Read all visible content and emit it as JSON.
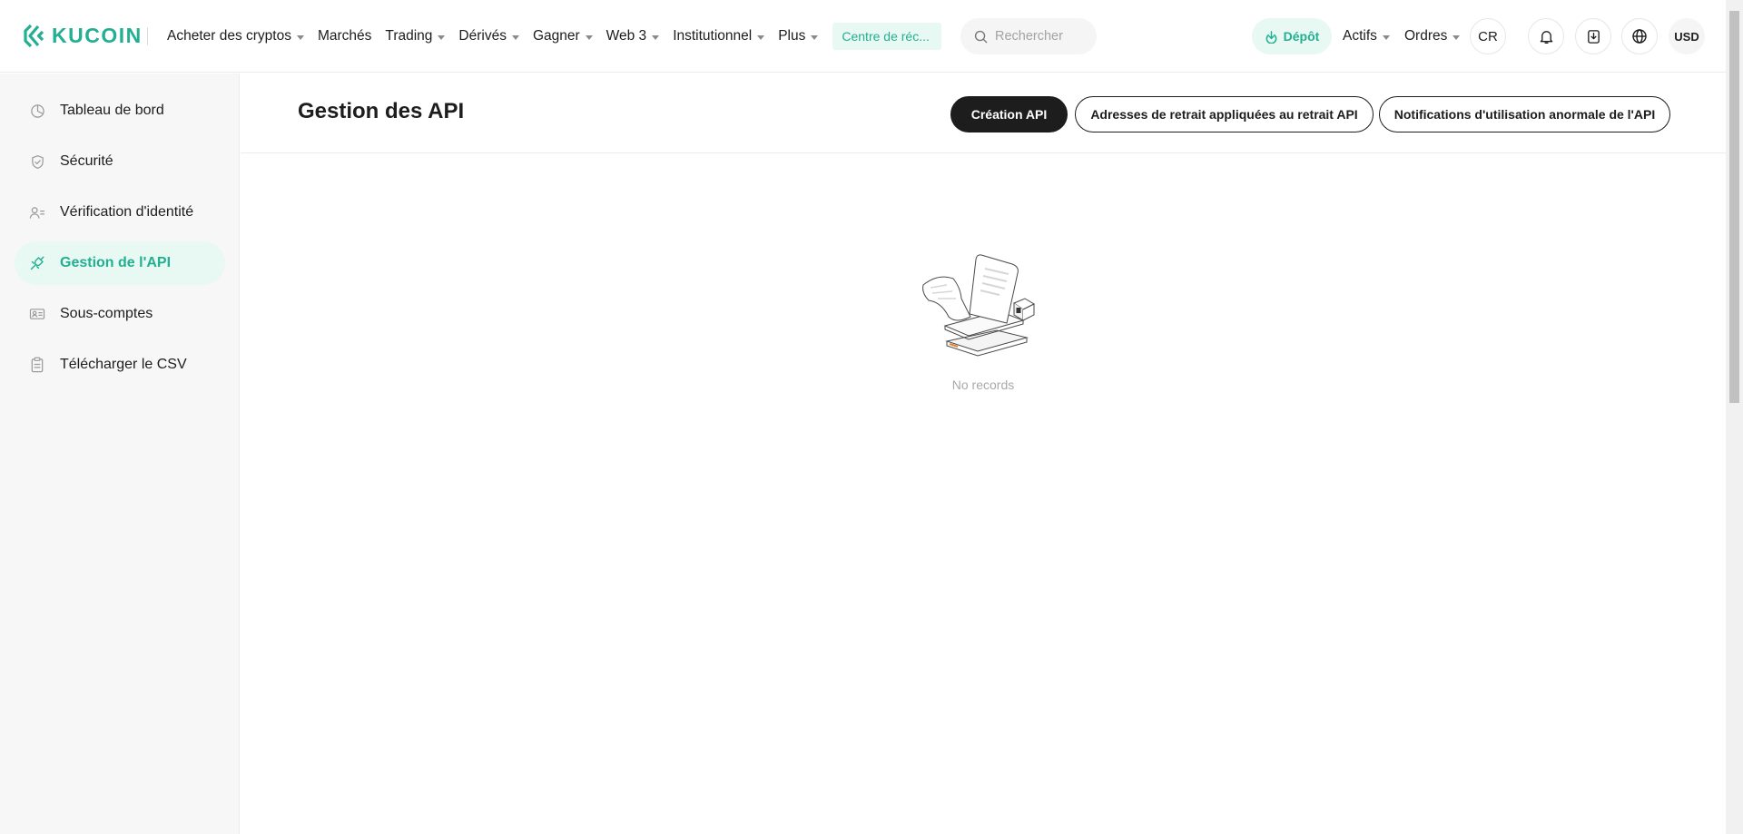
{
  "brand": {
    "name": "KUCOIN",
    "color": "#23af91"
  },
  "nav": {
    "items": [
      {
        "label": "Acheter des cryptos",
        "dropdown": true
      },
      {
        "label": "Marchés",
        "dropdown": false
      },
      {
        "label": "Trading",
        "dropdown": true
      },
      {
        "label": "Dérivés",
        "dropdown": true
      },
      {
        "label": "Gagner",
        "dropdown": true
      },
      {
        "label": "Web 3",
        "dropdown": true
      },
      {
        "label": "Institutionnel",
        "dropdown": true
      },
      {
        "label": "Plus",
        "dropdown": true
      }
    ],
    "promo": "Centre de réc...",
    "search_placeholder": "Rechercher"
  },
  "header_right": {
    "deposit": "Dépôt",
    "assets": "Actifs",
    "orders": "Ordres",
    "avatar": "CR",
    "currency": "USD",
    "icons": [
      "bell-icon",
      "download-icon",
      "globe-icon"
    ]
  },
  "sidebar": {
    "items": [
      {
        "label": "Tableau de bord",
        "icon": "pie-chart-icon",
        "active": false
      },
      {
        "label": "Sécurité",
        "icon": "shield-icon",
        "active": false
      },
      {
        "label": "Vérification d'identité",
        "icon": "user-id-icon",
        "active": false
      },
      {
        "label": "Gestion de l'API",
        "icon": "api-plug-icon",
        "active": true
      },
      {
        "label": "Sous-comptes",
        "icon": "subaccount-icon",
        "active": false
      },
      {
        "label": "Télécharger le CSV",
        "icon": "clipboard-icon",
        "active": false
      }
    ]
  },
  "main": {
    "title": "Gestion des API",
    "buttons": {
      "create": "Création API",
      "withdraw_addresses": "Adresses de retrait appliquées au retrait API",
      "abnormal_notifications": "Notifications d'utilisation anormale de l'API"
    },
    "empty_text": "No records"
  }
}
